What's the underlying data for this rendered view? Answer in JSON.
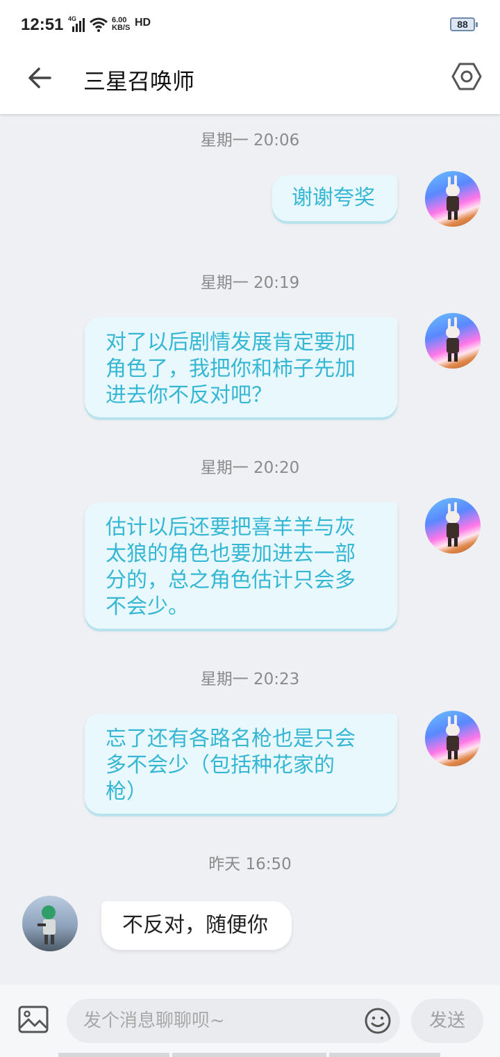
{
  "status_bar": {
    "time": "12:51",
    "network": "4G",
    "speed_top": "6.00",
    "speed_bottom": "KB/S",
    "hd": "HD",
    "battery": "88"
  },
  "header": {
    "title": "三星召唤师"
  },
  "messages": [
    {
      "timestamp": "星期一 20:06",
      "side": "right",
      "text": "谢谢夸奖"
    },
    {
      "timestamp": "星期一 20:19",
      "side": "right",
      "lines": [
        "对了以后剧情发展肯定要加",
        "角色了，我把你和柿子先加",
        "进去你不反对吧？"
      ]
    },
    {
      "timestamp": "星期一 20:20",
      "side": "right",
      "lines": [
        "估计以后还要把喜羊羊与灰",
        "太狼的角色也要加进去一部",
        "分的，总之角色估计只会多",
        "不会少。"
      ]
    },
    {
      "timestamp": "星期一 20:23",
      "side": "right",
      "lines": [
        "忘了还有各路名枪也是只会",
        "多不会少（包括种花家的",
        "枪）"
      ]
    },
    {
      "timestamp": "昨天 16:50",
      "side": "left",
      "text": "不反对，随便你"
    }
  ],
  "input_bar": {
    "placeholder": "发个消息聊聊呗~",
    "send_label": "发送"
  },
  "colors": {
    "bubble_text": "#35b7d4",
    "bubble_bg": "#e9f8fd",
    "background": "#eef0f3"
  }
}
